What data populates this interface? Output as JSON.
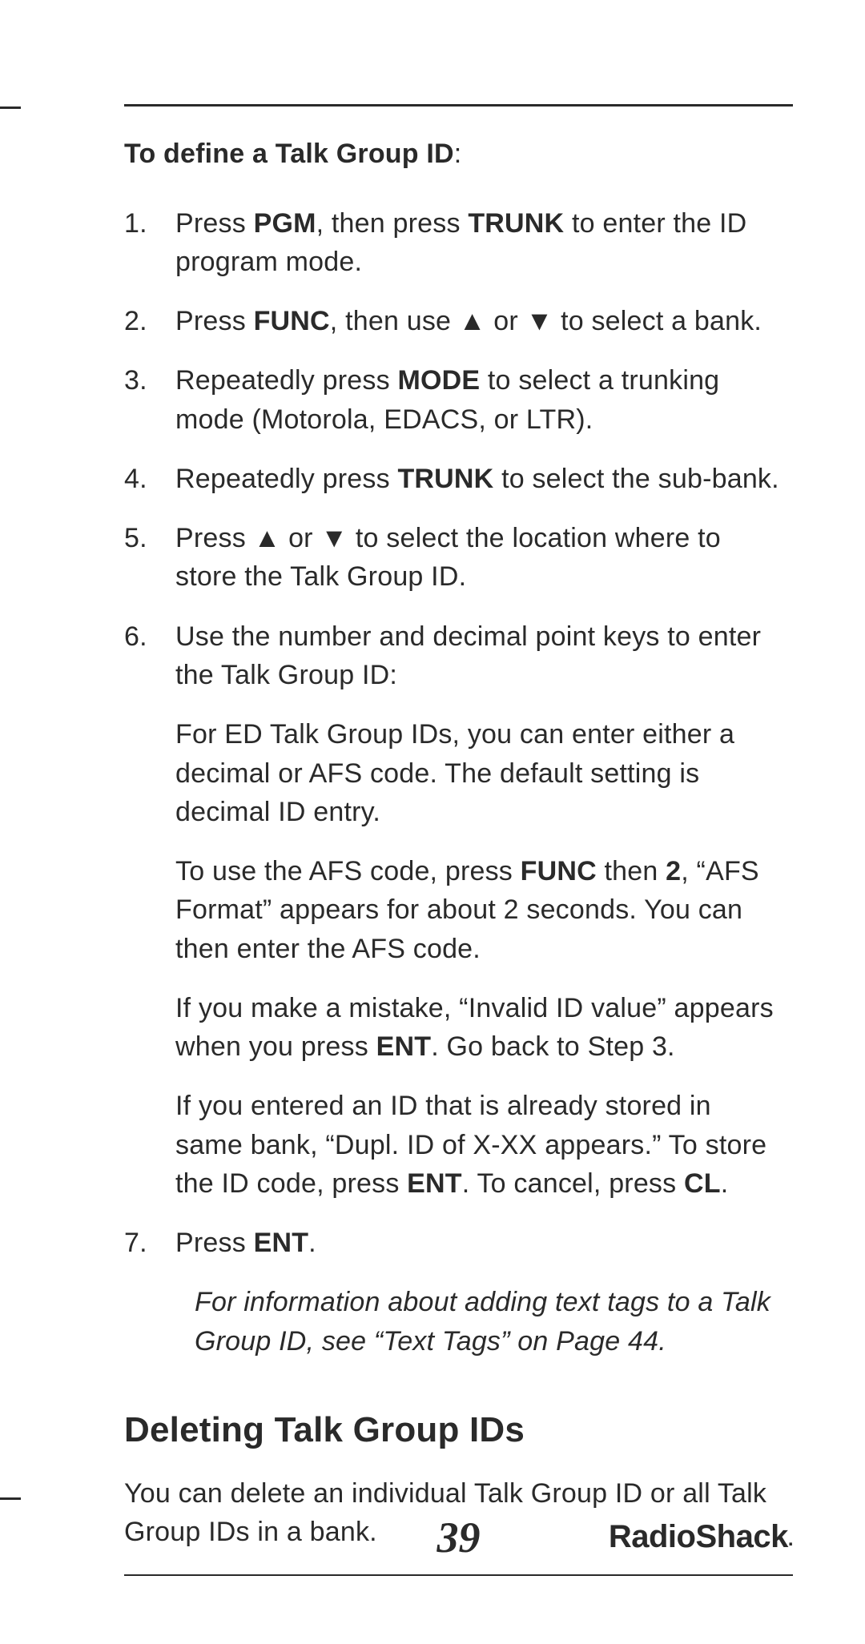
{
  "edge_text": "",
  "intro": {
    "prefix": "To define a Talk Group ID",
    "suffix": ":"
  },
  "steps": [
    {
      "num": "1.",
      "segments": [
        {
          "t": "Press "
        },
        {
          "t": "PGM",
          "b": true
        },
        {
          "t": ", then press "
        },
        {
          "t": "TRUNK",
          "b": true
        },
        {
          "t": " to enter the ID program mode."
        }
      ]
    },
    {
      "num": "2.",
      "segments": [
        {
          "t": "Press "
        },
        {
          "t": "FUNC",
          "b": true
        },
        {
          "t": ", then use "
        },
        {
          "t": "▲",
          "arrow": true
        },
        {
          "t": " or "
        },
        {
          "t": "▼",
          "arrow": true
        },
        {
          "t": " to select a bank."
        }
      ]
    },
    {
      "num": "3.",
      "segments": [
        {
          "t": "Repeatedly press "
        },
        {
          "t": "MODE",
          "b": true
        },
        {
          "t": " to select a trunking mode (Motorola, EDACS, or LTR)."
        }
      ]
    },
    {
      "num": "4.",
      "segments": [
        {
          "t": "Repeatedly press "
        },
        {
          "t": "TRUNK",
          "b": true
        },
        {
          "t": " to select the sub-bank."
        }
      ]
    },
    {
      "num": "5.",
      "segments": [
        {
          "t": "Press "
        },
        {
          "t": "▲",
          "arrow": true
        },
        {
          "t": " or "
        },
        {
          "t": "▼",
          "arrow": true
        },
        {
          "t": " to select the location where to store the Talk Group ID."
        }
      ]
    },
    {
      "num": "6.",
      "paras": [
        [
          {
            "t": "Use the number and decimal point keys to enter the Talk Group ID:"
          }
        ],
        [
          {
            "t": "For ED Talk Group IDs, you can enter either a decimal or AFS code. The default setting is decimal ID entry."
          }
        ],
        [
          {
            "t": "To use the AFS code, press "
          },
          {
            "t": "FUNC",
            "b": true
          },
          {
            "t": " then "
          },
          {
            "t": "2",
            "b": true
          },
          {
            "t": ", “AFS Format” appears for about 2 seconds. You can then enter the AFS code."
          }
        ],
        [
          {
            "t": "If you make a mistake, “Invalid ID value” appears when you press "
          },
          {
            "t": "ENT",
            "b": true
          },
          {
            "t": ". Go back to Step 3."
          }
        ],
        [
          {
            "t": "If you entered an ID that is already stored in same bank, “Dupl. ID of X-XX appears.” To store the ID code, press "
          },
          {
            "t": "ENT",
            "b": true
          },
          {
            "t": ". To cancel, press "
          },
          {
            "t": "CL",
            "b": true
          },
          {
            "t": "."
          }
        ]
      ]
    },
    {
      "num": "7.",
      "segments": [
        {
          "t": "Press "
        },
        {
          "t": "ENT",
          "b": true
        },
        {
          "t": "."
        }
      ],
      "note": "For information about adding text tags to a Talk Group ID, see “Text Tags” on Page 44."
    }
  ],
  "section_heading": "Deleting Talk Group IDs",
  "section_body": "You can delete an individual Talk Group ID or all Talk Group IDs in a bank.",
  "page_number": "39",
  "brand_first": "Radio",
  "brand_second": "Shack",
  "brand_dot": "."
}
